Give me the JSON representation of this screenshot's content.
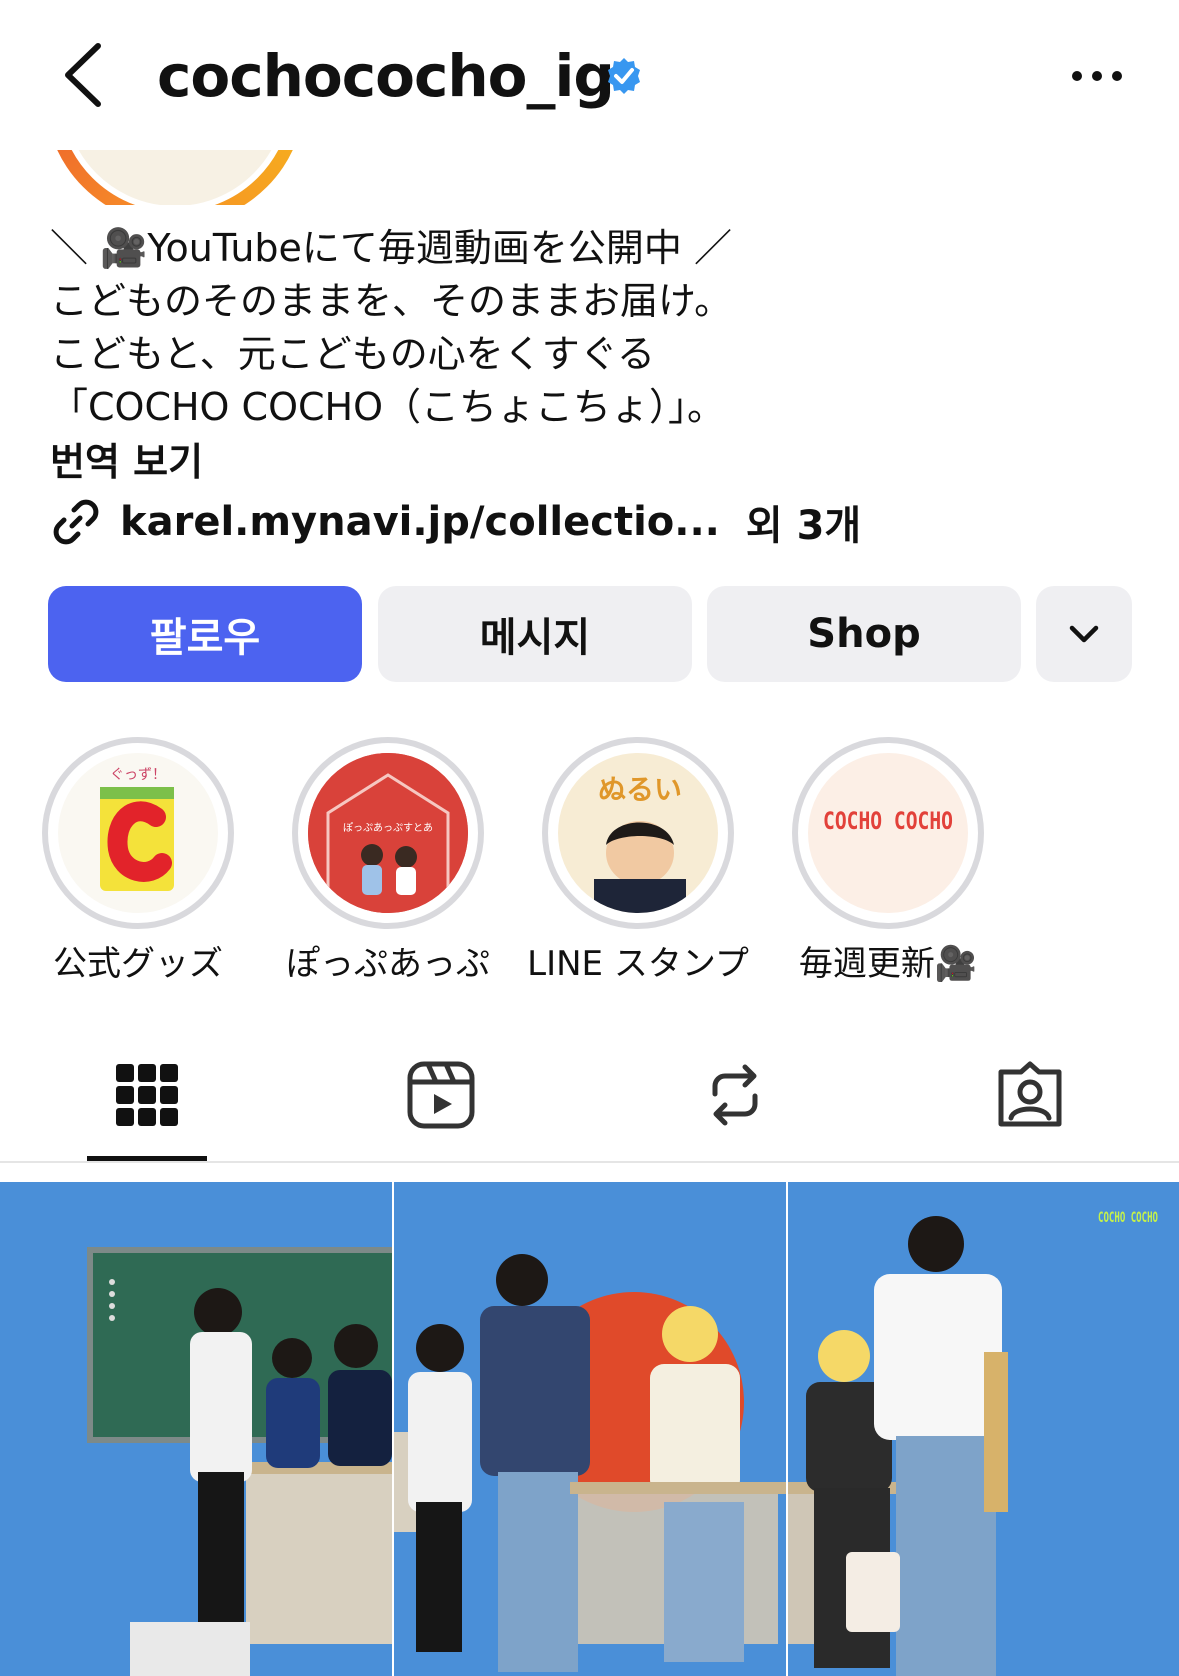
{
  "header": {
    "username": "cochococho_ig",
    "back_icon": "chevron-left-icon",
    "verified_icon": "verified-badge-icon",
    "more_icon": "more-horizontal-icon"
  },
  "bio": {
    "lines": [
      "＼ 🎥YouTubeにて毎週動画を公開中 ／",
      "こどものそのままを、そのままお届け。",
      "こどもと、元こどもの心をくすぐる",
      "「COCHO COCHO（こちょこちょ）」。"
    ],
    "translate_label": "번역 보기",
    "link": {
      "icon": "link-icon",
      "text": "karel.mynavi.jp/collectio...",
      "more": "외 3개"
    }
  },
  "buttons": {
    "follow": "팔로우",
    "message": "메시지",
    "shop": "Shop",
    "more_icon": "chevron-down-icon"
  },
  "highlights": [
    {
      "label": "公式グッズ"
    },
    {
      "label": "ぽっぷあっぷ"
    },
    {
      "label": "LINE スタンプ"
    },
    {
      "label": "毎週更新🎥"
    }
  ],
  "highlight_art": {
    "goods_top": "ぐっず！",
    "popup_sign": "ぽっぷあっぷすとあ",
    "line_word": "ぬるい",
    "brand": "COCHO COCHO"
  },
  "tabs": [
    {
      "name": "grid-icon",
      "active": true
    },
    {
      "name": "reels-icon",
      "active": false
    },
    {
      "name": "repost-icon",
      "active": false
    },
    {
      "name": "tagged-icon",
      "active": false
    }
  ],
  "post": {
    "brand_mark": "COCHO COCHO"
  },
  "colors": {
    "follow_blue": "#4c63f0",
    "verified_blue": "#3897f0",
    "button_gray": "#efeff2",
    "post_bg": "#4a8fd8"
  }
}
